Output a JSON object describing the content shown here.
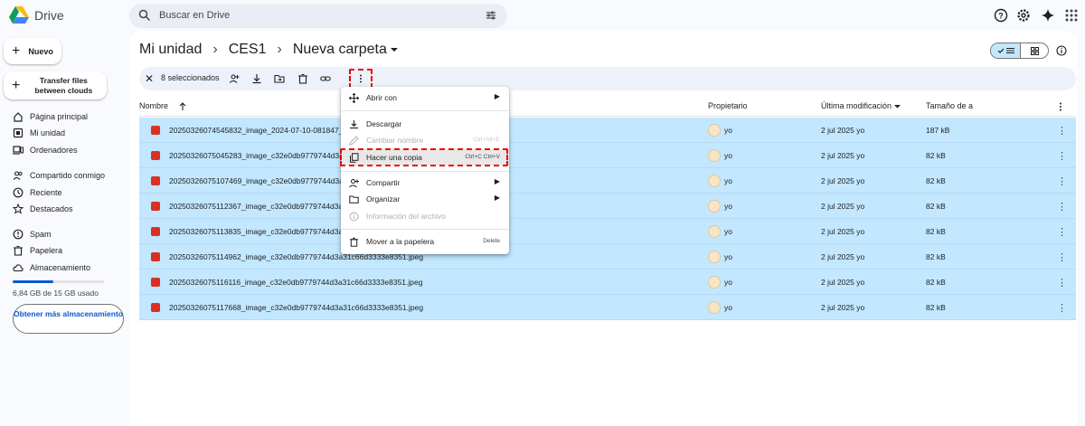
{
  "app": {
    "name": "Drive"
  },
  "search": {
    "placeholder": "Buscar en Drive"
  },
  "sidebar": {
    "new_label": "Nuevo",
    "transfer_label": "Transfer files between clouds",
    "items": [
      {
        "label": "Página principal",
        "icon": "home-icon"
      },
      {
        "label": "Mi unidad",
        "icon": "drive-icon"
      },
      {
        "label": "Ordenadores",
        "icon": "computer-icon"
      },
      {
        "label": "Compartido conmigo",
        "icon": "people-icon"
      },
      {
        "label": "Reciente",
        "icon": "clock-icon"
      },
      {
        "label": "Destacados",
        "icon": "star-icon"
      },
      {
        "label": "Spam",
        "icon": "spam-icon"
      },
      {
        "label": "Papelera",
        "icon": "trash-icon"
      },
      {
        "label": "Almacenamiento",
        "icon": "cloud-icon"
      }
    ],
    "storage_used_fraction": 0.45,
    "storage_text": "6,84 GB de 15 GB usado",
    "get_storage_label": "Obtener más almacenamiento"
  },
  "breadcrumb": {
    "root": "Mi unidad",
    "middle": "CES1",
    "current": "Nueva carpeta",
    "separator": "›"
  },
  "action_bar": {
    "selected_count": "8 seleccionados"
  },
  "table": {
    "columns": {
      "name": "Nombre",
      "owner": "Propietario",
      "modified": "Última modificación",
      "size": "Tamaño de a"
    },
    "rows": [
      {
        "name": "20250326074545832_image_2024-07-10-081847_",
        "owner": "yo",
        "modified": "2 jul 2025 yo",
        "size": "187 kB"
      },
      {
        "name": "20250326075045283_image_c32e0db9779744d3a",
        "owner": "yo",
        "modified": "2 jul 2025 yo",
        "size": "82 kB"
      },
      {
        "name": "20250326075107469_image_c32e0db9779744d3a",
        "owner": "yo",
        "modified": "2 jul 2025 yo",
        "size": "82 kB"
      },
      {
        "name": "20250326075112367_image_c32e0db9779744d3a",
        "owner": "yo",
        "modified": "2 jul 2025 yo",
        "size": "82 kB"
      },
      {
        "name": "20250326075113835_image_c32e0db9779744d3a",
        "owner": "yo",
        "modified": "2 jul 2025 yo",
        "size": "82 kB"
      },
      {
        "name": "20250326075114962_image_c32e0db9779744d3a31c66d3333e8351.jpeg",
        "owner": "yo",
        "modified": "2 jul 2025 yo",
        "size": "82 kB"
      },
      {
        "name": "20250326075116116_image_c32e0db9779744d3a31c66d3333e8351.jpeg",
        "owner": "yo",
        "modified": "2 jul 2025 yo",
        "size": "82 kB"
      },
      {
        "name": "20250326075117668_image_c32e0db9779744d3a31c66d3333e8351.jpeg",
        "owner": "yo",
        "modified": "2 jul 2025 yo",
        "size": "82 kB"
      }
    ]
  },
  "context_menu": {
    "open_with": "Abrir con",
    "download": "Descargar",
    "rename": "Cambiar nombre",
    "rename_shortcut": "Ctrl+Alt+E",
    "copy": "Hacer una copia",
    "copy_shortcut": "Ctrl+C Ctrl+V",
    "share": "Compartir",
    "organize": "Organizar",
    "file_info": "Información del archivo",
    "trash": "Mover a la papelera",
    "trash_shortcut": "Delete"
  },
  "colors": {
    "accent": "#0b57d0",
    "selection": "#c2e7ff",
    "highlight": "#e00000"
  }
}
